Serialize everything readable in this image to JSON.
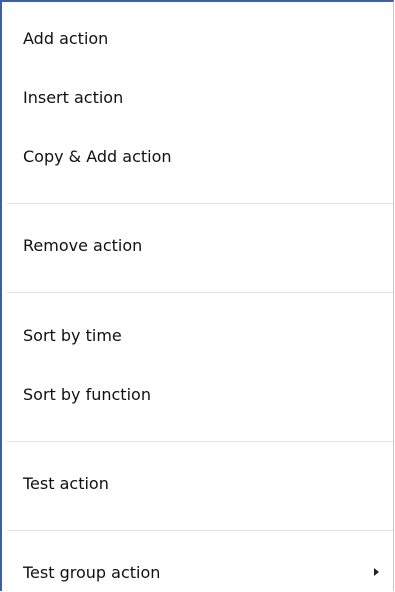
{
  "menu": {
    "items": [
      {
        "label": "Add action"
      },
      {
        "label": "Insert action"
      },
      {
        "label": "Copy & Add action"
      },
      {
        "label": "Remove action"
      },
      {
        "label": "Sort by time"
      },
      {
        "label": "Sort by function"
      },
      {
        "label": "Test action"
      },
      {
        "label": "Test group action",
        "submenu_icon": "submenu-arrow-icon"
      }
    ]
  }
}
